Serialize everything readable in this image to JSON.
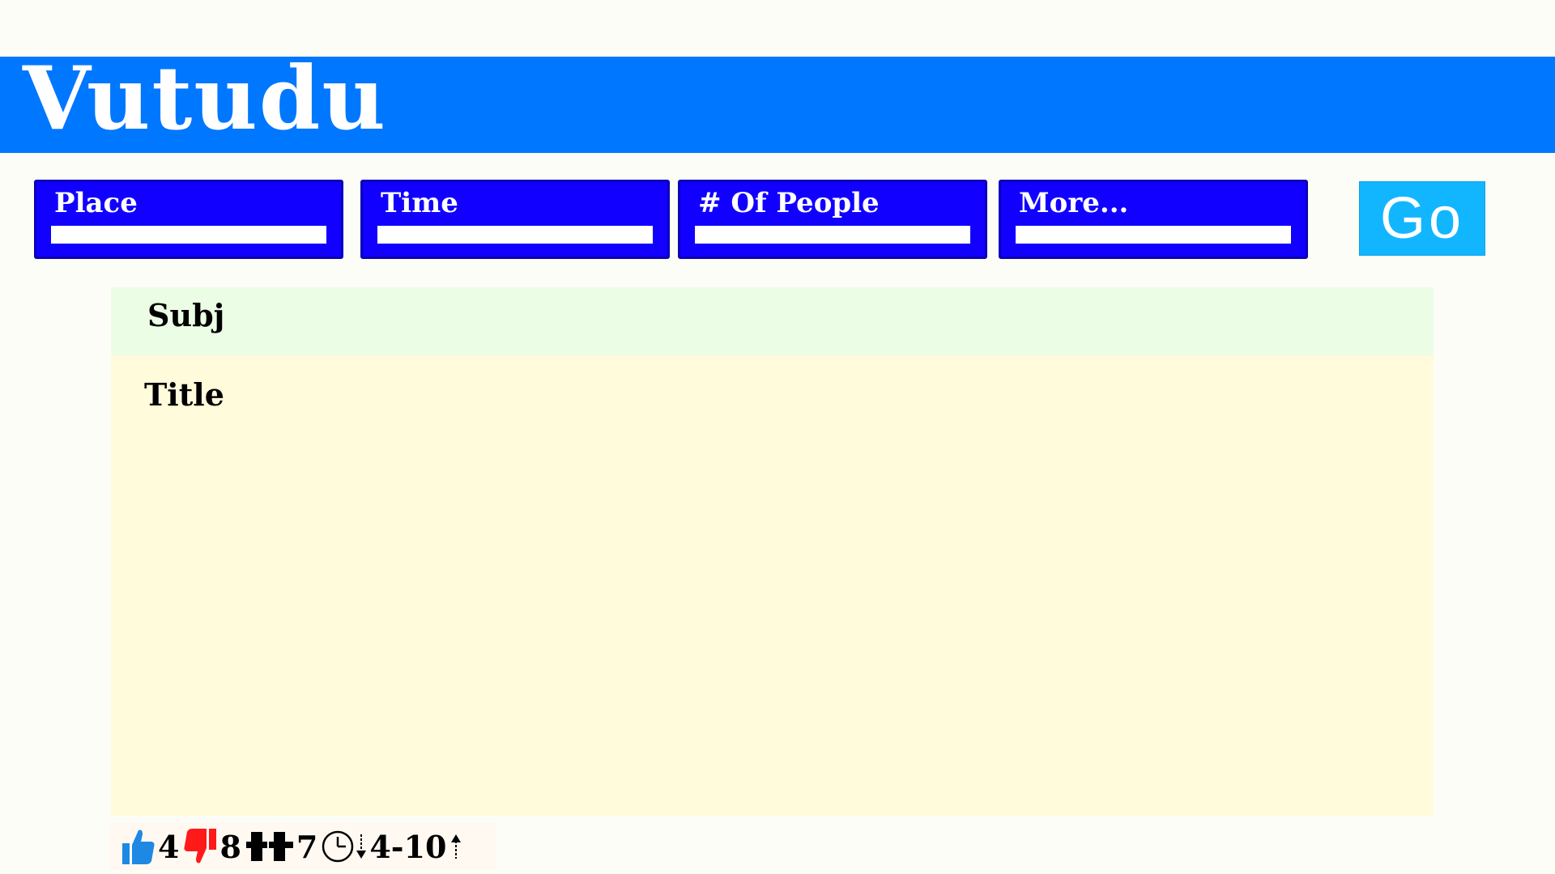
{
  "app": {
    "logo_text": "Vutudu"
  },
  "filters": [
    {
      "label": "Place",
      "value": ""
    },
    {
      "label": "Time",
      "value": ""
    },
    {
      "label": "# Of People",
      "value": ""
    },
    {
      "label": "More...",
      "value": ""
    }
  ],
  "go_button": {
    "label": "Go"
  },
  "post": {
    "subject_label": "Subj",
    "title_label": "Title"
  },
  "stats": {
    "likes": "4",
    "dislikes": "8",
    "people": "7",
    "time_range": "4-10"
  },
  "colors": {
    "banner": "#0077ff",
    "filter_bg": "#1100ff",
    "go_button": "#12b6ff",
    "subject_bg": "#ecfde6",
    "content_bg": "#fffbdb",
    "like_icon": "#1e88e5",
    "dislike_icon": "#ff1a1a"
  },
  "icons": {
    "like": "thumbs-up-icon",
    "dislike": "thumbs-down-icon",
    "people": "people-icon",
    "time": "clock-icon",
    "sort_down": "arrow-down-icon",
    "sort_up": "arrow-up-icon"
  }
}
